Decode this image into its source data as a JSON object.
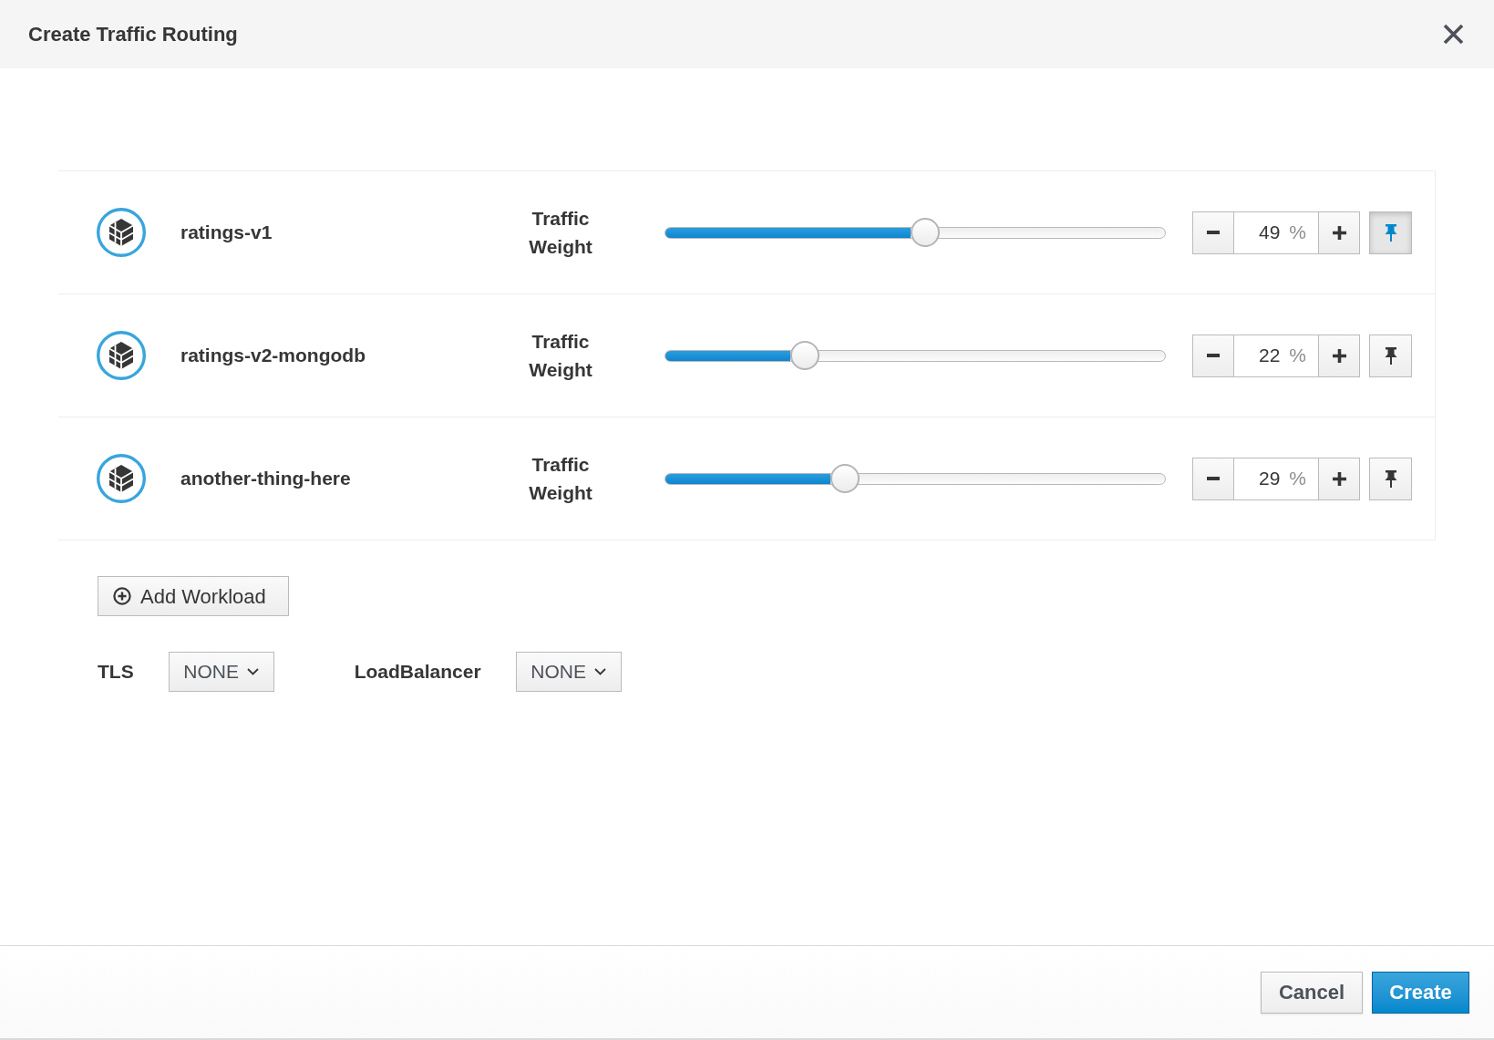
{
  "dialog": {
    "title": "Create Traffic Routing"
  },
  "workloads": [
    {
      "name": "ratings-v1",
      "weight_label": "Traffic Weight",
      "level": 0.52,
      "value": "49",
      "unit": "%",
      "pinned": true
    },
    {
      "name": "ratings-v2-mongodb",
      "weight_label": "Traffic Weight",
      "level": 0.28,
      "value": "22",
      "unit": "%",
      "pinned": false
    },
    {
      "name": "another-thing-here",
      "weight_label": "Traffic Weight",
      "level": 0.36,
      "value": "29",
      "unit": "%",
      "pinned": false
    }
  ],
  "add_workload_button": {
    "label": "Add Workload"
  },
  "settings": [
    {
      "label": "TLS",
      "value": "NONE"
    },
    {
      "label": "LoadBalancer",
      "value": "NONE"
    }
  ],
  "footer": {
    "buttons": [
      {
        "label": "Cancel",
        "kind": "secondary"
      },
      {
        "label": "Create",
        "kind": "primary"
      }
    ]
  }
}
